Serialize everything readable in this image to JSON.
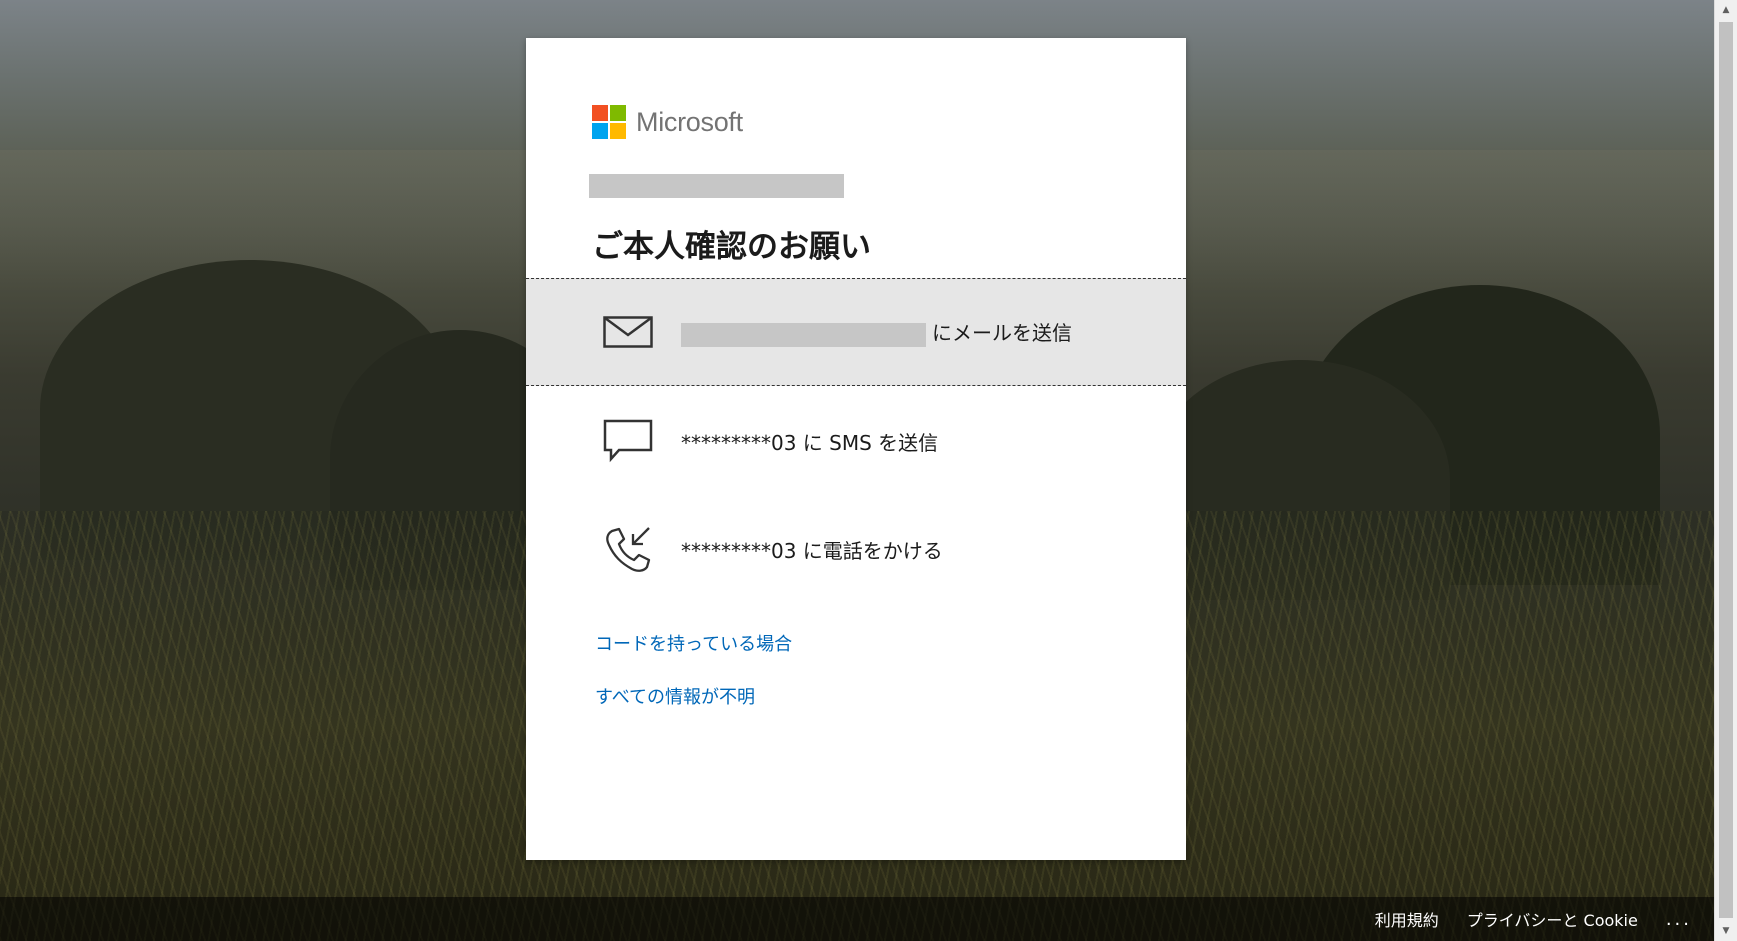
{
  "brand": {
    "name": "Microsoft"
  },
  "title": "ご本人確認のお願い",
  "options": [
    {
      "icon": "envelope-icon",
      "label_suffix": "にメールを送信"
    },
    {
      "icon": "chat-icon",
      "label": "*********03 に SMS を送信"
    },
    {
      "icon": "phone-call-icon",
      "label": "*********03 に電話をかける"
    }
  ],
  "links": {
    "have_code": "コードを持っている場合",
    "none_available": "すべての情報が不明"
  },
  "footer": {
    "terms": "利用規約",
    "privacy": "プライバシーと Cookie",
    "more": "..."
  },
  "colors": {
    "link": "#0067b8",
    "selected_bg": "#e6e6e6",
    "redaction": "#c6c6c6"
  }
}
